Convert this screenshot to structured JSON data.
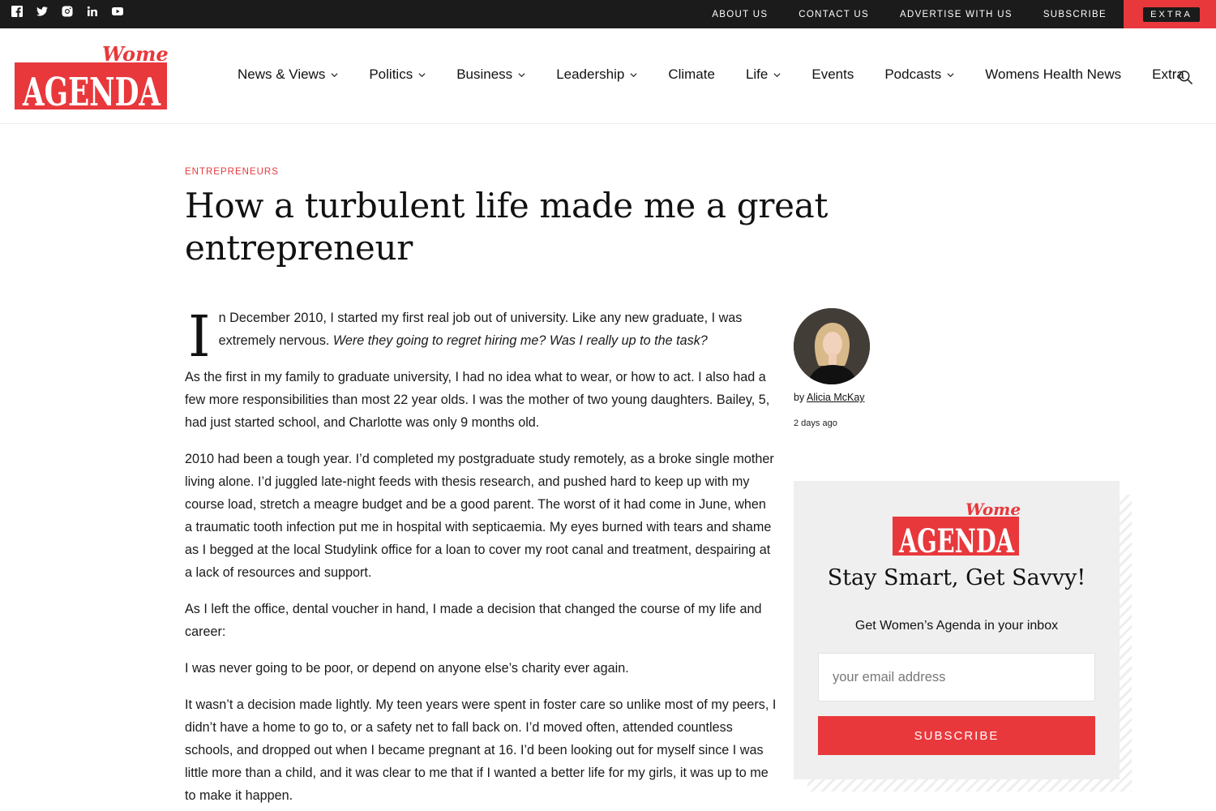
{
  "colors": {
    "accent": "#e8383c",
    "topbar": "#1b1b1b"
  },
  "topbar": {
    "social": [
      {
        "name": "facebook-icon"
      },
      {
        "name": "twitter-icon"
      },
      {
        "name": "instagram-icon"
      },
      {
        "name": "linkedin-icon"
      },
      {
        "name": "youtube-icon"
      }
    ],
    "links": [
      "ABOUT US",
      "CONTACT US",
      "ADVERTISE WITH US",
      "SUBSCRIBE"
    ],
    "extra": "EXTRA"
  },
  "logo": {
    "top": "Women's",
    "main": "AGENDA"
  },
  "nav": [
    {
      "label": "News & Views",
      "dropdown": true
    },
    {
      "label": "Politics",
      "dropdown": true
    },
    {
      "label": "Business",
      "dropdown": true
    },
    {
      "label": "Leadership",
      "dropdown": true
    },
    {
      "label": "Climate",
      "dropdown": false
    },
    {
      "label": "Life",
      "dropdown": true
    },
    {
      "label": "Events",
      "dropdown": false
    },
    {
      "label": "Podcasts",
      "dropdown": true
    },
    {
      "label": "Womens Health News",
      "dropdown": false
    },
    {
      "label": "Extra",
      "dropdown": false
    }
  ],
  "article": {
    "category": "ENTREPRENEURS",
    "title": "How a turbulent life made me a great entrepreneur",
    "dropcap": "I",
    "p1_plain": "n December 2010, I started my first real job out of university. Like any new graduate, I was extremely nervous. ",
    "p1_italic": "Were they going to regret hiring me? Was I really up to the task?",
    "paragraphs": [
      "As the first in my family to graduate university, I had no idea what to wear, or how to act. I also had a few more responsibilities than most 22 year olds. I was the mother of two young daughters. Bailey, 5, had just started school, and Charlotte was only 9 months old.",
      "2010 had been a tough year. I’d completed my postgraduate study remotely, as a broke single mother living alone. I’d juggled late-night feeds with thesis research, and pushed hard to keep up with my course load, stretch a meagre budget and be a good parent. The worst of it had come in June, when a traumatic tooth infection put me in hospital with septicaemia. My eyes burned with tears and shame as I begged at the local Studylink office for a loan to cover my root canal and treatment, despairing at a lack of resources and support.",
      "As I left the office, dental voucher in hand, I made a decision that changed the course of my life and career:",
      "I was never going to be poor, or depend on anyone else’s charity ever again.",
      "It wasn’t a decision made lightly. My teen years were spent in foster care so unlike most of my peers, I didn’t have a home to go to, or a safety net to fall back on. I’d moved often, attended countless schools, and dropped out when I became pregnant at 16. I’d been looking out for myself since I was little more than a child, and it was clear to me that if I wanted a better life for my girls, it was up to me to make it happen."
    ]
  },
  "author": {
    "by": "by ",
    "name": "Alicia McKay",
    "time": "2 days ago"
  },
  "newsletter": {
    "title": "Stay Smart, Get Savvy!",
    "subtitle": "Get Women’s Agenda in your inbox",
    "placeholder": "your email address",
    "button": "SUBSCRIBE"
  }
}
